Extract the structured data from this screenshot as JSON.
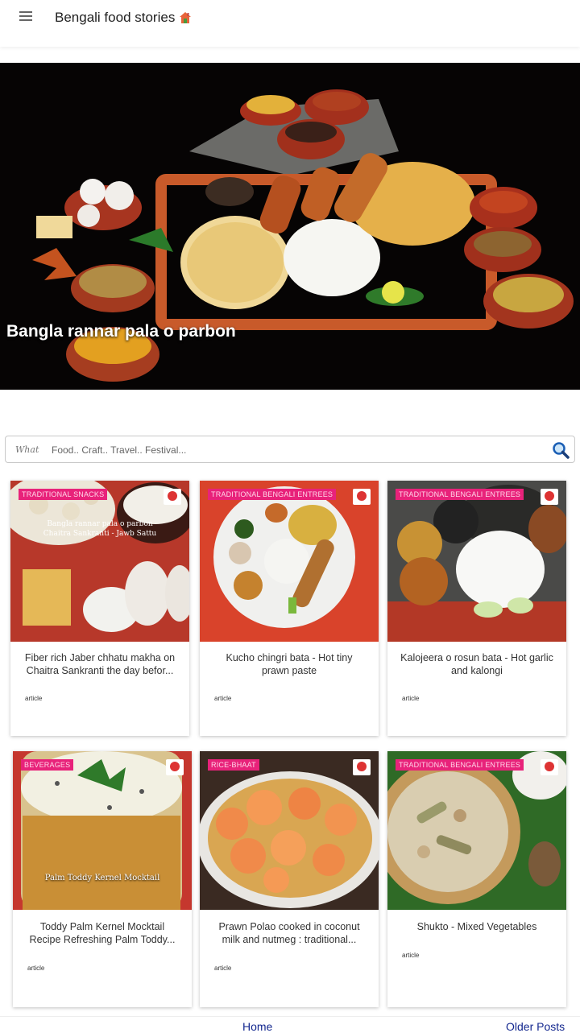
{
  "header": {
    "title": "Bengali food stories",
    "menu_icon": "hamburger-menu-icon",
    "title_icon": "house-icon"
  },
  "hero": {
    "title": "Bangla rannar pala o parbon"
  },
  "search": {
    "label": "What",
    "placeholder": "Food.. Craft.. Travel.. Festival...",
    "icon": "search-icon"
  },
  "posts": [
    {
      "tag": "Traditional snacks",
      "overlay": "Bangla rannar pala o parbon\nChaitra Sankranti - Jawb Sattu",
      "title": "Fiber rich Jaber chhatu makha on Chaitra Sankranti the day befor...",
      "kind": "article"
    },
    {
      "tag": "Traditional Bengali Entrees",
      "overlay": "",
      "title": "Kucho chingri bata - Hot tiny prawn paste",
      "kind": "article"
    },
    {
      "tag": "Traditional Bengali Entrees",
      "overlay": "",
      "title": "Kalojeera o rosun bata - Hot garlic and kalongi",
      "kind": "article"
    },
    {
      "tag": "Beverages",
      "overlay": "Palm Toddy Kernel Mocktail",
      "title": "Toddy Palm Kernel Mocktail Recipe Refreshing Palm Toddy...",
      "kind": "article"
    },
    {
      "tag": "Rice-Bhaat",
      "overlay": "",
      "title": "Prawn Polao cooked in coconut milk and nutmeg : traditional...",
      "kind": "article"
    },
    {
      "tag": "Traditional Bengali Entrees",
      "overlay": "",
      "title": "Shukto - Mixed Vegetables",
      "kind": "article"
    }
  ],
  "footer": {
    "home": "Home",
    "older": "Older Posts"
  }
}
